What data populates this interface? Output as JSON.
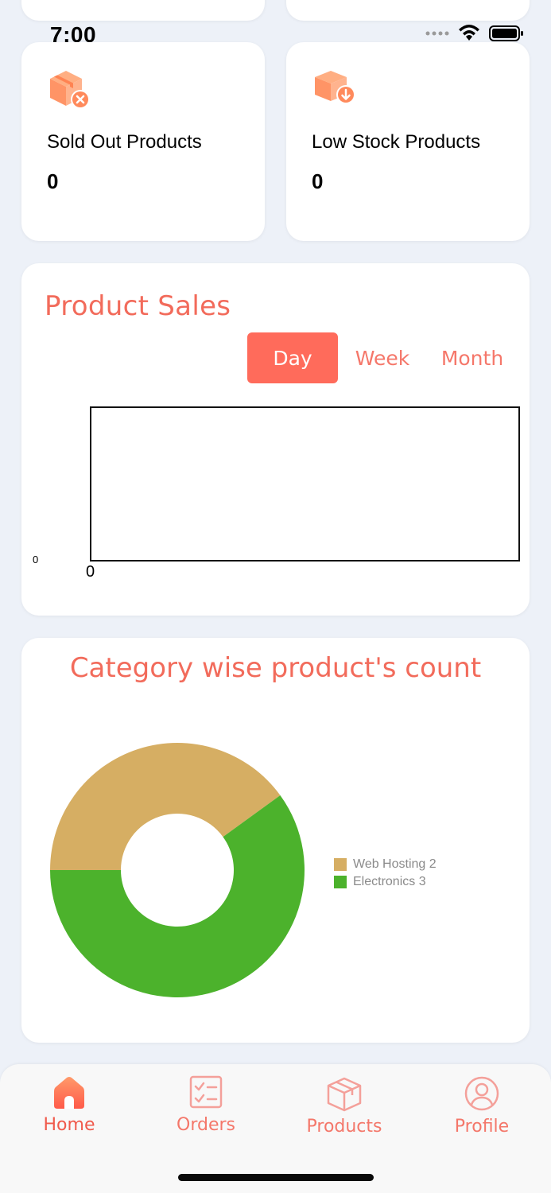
{
  "status_bar": {
    "time": "7:00",
    "icons": [
      "signal-dots-icon",
      "wifi-icon",
      "battery-icon"
    ]
  },
  "stats": [
    {
      "label": "Sold Out Products",
      "value": "0",
      "icon": "box-x-icon"
    },
    {
      "label": "Low Stock Products",
      "value": "0",
      "icon": "box-down-icon"
    }
  ],
  "sales": {
    "title": "Product Sales",
    "tabs": [
      "Day",
      "Week",
      "Month"
    ],
    "active_tab": "Day",
    "y_tick": "0",
    "x_tick": "0"
  },
  "category": {
    "title": "Category wise product's count"
  },
  "chart_data": {
    "type": "pie",
    "title": "Category wise product's count",
    "categories": [
      "Web Hosting",
      "Electronics"
    ],
    "values": [
      2,
      3
    ],
    "labels": [
      "Web Hosting 2",
      "Electronics 3"
    ],
    "colors": [
      "#d6ae63",
      "#4cb22c"
    ],
    "donut": true,
    "legend": "right"
  },
  "tabbar": {
    "items": [
      {
        "label": "Home",
        "icon": "home-icon",
        "active": true
      },
      {
        "label": "Orders",
        "icon": "orders-icon",
        "active": false
      },
      {
        "label": "Products",
        "icon": "products-icon",
        "active": false
      },
      {
        "label": "Profile",
        "icon": "profile-icon",
        "active": false
      }
    ]
  },
  "colors": {
    "accent": "#ff6b5b",
    "background": "#edf1f8",
    "card": "#ffffff"
  }
}
